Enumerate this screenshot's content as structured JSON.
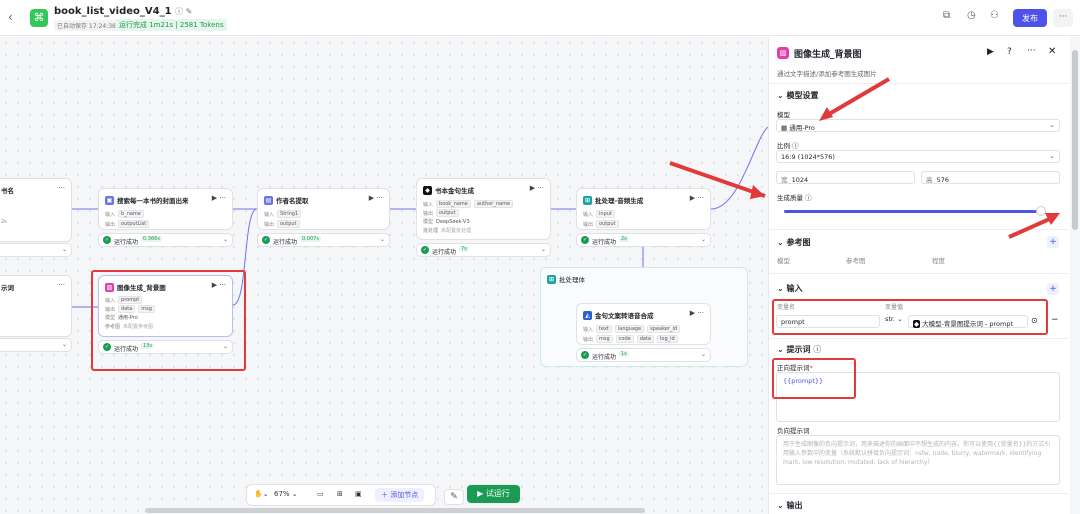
{
  "header": {
    "title": "book_list_video_V4_1",
    "saved": "已自动保存 17:24:38",
    "run_status": "运行完成 1m21s | 2581 Tokens",
    "publish": "发布",
    "more": "···"
  },
  "canvas": {
    "nodes": {
      "partial_top": {
        "title": "书名",
        "row1": "2s"
      },
      "partial_mid": {
        "title": "示词"
      },
      "search_cover": {
        "title": "搜索每一本书的封面出来",
        "in_label": "输入",
        "in_chip": "b_name",
        "out_label": "输出",
        "out_chip": "outputList",
        "run": "运行成功",
        "time": "0.366s"
      },
      "author": {
        "title": "作者名提取",
        "in_label": "输入",
        "in_chip": "String1",
        "out_label": "输出",
        "out_chip": "output",
        "run": "运行成功",
        "time": "0.007s"
      },
      "quote_gen": {
        "title": "书本金句生成",
        "in_label": "输入",
        "in_chip1": "book_name",
        "in_chip2": "author_name",
        "out_label": "输出",
        "out_chip": "output",
        "model_label": "模型",
        "model": "DeepSeek-V3",
        "batch_label": "批处理",
        "batch": "未配置批处理",
        "run": "运行成功",
        "time": "7s"
      },
      "batch_audio": {
        "title": "批处理-音频生成",
        "in_label": "输入",
        "in_chip": "input",
        "out_label": "输出",
        "out_chip": "output",
        "run": "运行成功",
        "time": "2s"
      },
      "bg_image": {
        "title": "图像生成_背景图",
        "in_label": "输入",
        "in_chip": "prompt",
        "out_label": "输出",
        "out_chip1": "data",
        "out_chip2": "msg",
        "model_label": "模型",
        "model": "通用-Pro",
        "ref_label": "参考图",
        "ref": "未配置参考图",
        "run": "运行成功",
        "time": "13s"
      },
      "batch_body": {
        "title": "批处理体"
      },
      "tts": {
        "title": "金句文案转语音合成",
        "in_label": "输入",
        "in_chip1": "text",
        "in_chip2": "language",
        "in_chip3": "speaker_id",
        "out_label": "输出",
        "out_chip1": "msg",
        "out_chip2": "code",
        "out_chip3": "data",
        "out_chip4": "log_id",
        "run": "运行成功",
        "time": "1s"
      }
    }
  },
  "bottombar": {
    "zoom": "67%",
    "add_node": "添加节点",
    "run": "试运行"
  },
  "panel": {
    "title": "图像生成_背景图",
    "subtitle": "通过文字描述/添加参考图生成图片",
    "model_section": "模型设置",
    "model_label": "模型",
    "model_value": "通用-Pro",
    "ratio_label": "比例",
    "ratio_value": "16:9 (1024*576)",
    "width_label": "宽",
    "width_value": "1024",
    "height_label": "高",
    "height_value": "576",
    "quality_label": "生成质量",
    "quality_fraction": 0.98,
    "ref_section": "参考图",
    "ref_cols": [
      "模型",
      "参考图",
      "程度"
    ],
    "input_section": "输入",
    "var_name_label": "变量名",
    "var_value_label": "变量值",
    "var_name": "prompt",
    "var_type": "str.",
    "var_source": "大模型-背景图提示词 - prompt",
    "prompt_section": "提示词",
    "pos_label": "正向提示词",
    "pos_value": "{{prompt}}",
    "neg_label": "负向提示词",
    "neg_placeholder": "用于生成图像的负向提示词，用来描述你的画面中不想生成的内容，你可以使用{{变量名}}的方式引用输入参数中的变量（系统默认拼接负向提示词：nsfw, nude, blurry, watermark, identifying mark, low resolution, mutated, lack of hierarchy）",
    "output_section": "输出"
  },
  "colors": {
    "accent": "#4d53e8",
    "success": "#1a9b52",
    "highlight": "#e03a3a"
  }
}
